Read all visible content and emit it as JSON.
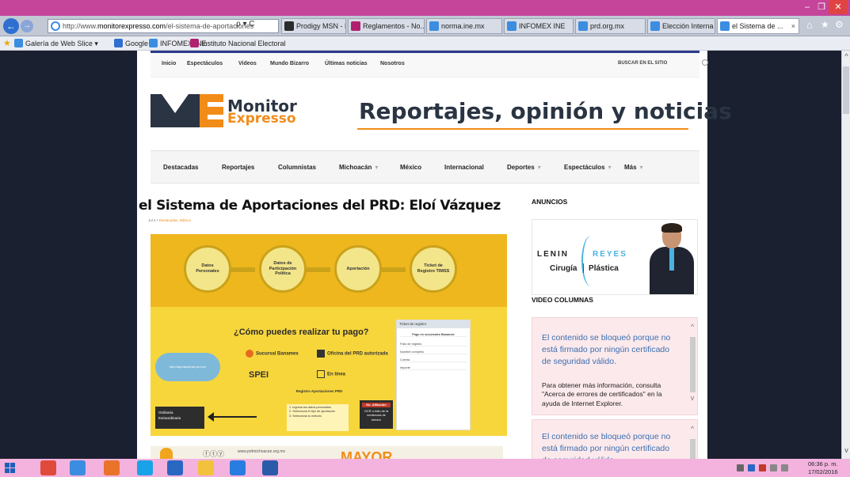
{
  "browser": {
    "window_buttons": {
      "minimize": "–",
      "maximize": "❐",
      "close": "✕"
    },
    "back_icon": "←",
    "forward_icon": "→",
    "url_prefix": "http://www.",
    "url_domain": "monitorexpresso.com",
    "url_path": "/el-sistema-de-aportaciones",
    "url_controls": "ρ ▾ C",
    "tabs": [
      {
        "label": "Prodigy MSN - Ho...",
        "color": "#2b2b2b"
      },
      {
        "label": "Reglamentos - No...",
        "color": "#b0206e"
      },
      {
        "label": "norma.ine.mx",
        "color": "#3b8de0"
      },
      {
        "label": "INFOMEX INE",
        "color": "#3b8de0"
      },
      {
        "label": "prd.org.mx",
        "color": "#3b8de0"
      },
      {
        "label": "Elección Interna P...",
        "color": "#3b8de0"
      },
      {
        "label": "el Sistema de ...",
        "color": "#3b8de0",
        "close": "×"
      }
    ],
    "toolbar_icons": {
      "home": "⌂",
      "favorites": "★",
      "settings": "⚙"
    },
    "favorites": [
      {
        "label": "Galería de Web Slice ▾",
        "color": "#3b8de0"
      },
      {
        "label": "Google",
        "color": "#2f6fd0"
      },
      {
        "label": "INFOMEX INE",
        "color": "#3b8de0"
      },
      {
        "label": "Instituto Nacional Electoral",
        "color": "#b0206e"
      }
    ]
  },
  "site": {
    "top_nav": [
      "Inicio",
      "Espectáculos",
      "Videos",
      "Mundo Bizarro",
      "Últimas noticias",
      "Nosotros"
    ],
    "search_label": "BUSCAR EN EL SITIO",
    "logo": {
      "mark": "ME",
      "name": "Monitor",
      "sub": "Expresso"
    },
    "tagline": "Reportajes, opinión y noticias",
    "main_nav": [
      {
        "label": "Destacadas",
        "dropdown": false
      },
      {
        "label": "Reportajes",
        "dropdown": false
      },
      {
        "label": "Columnistas",
        "dropdown": false
      },
      {
        "label": "Michoacán",
        "dropdown": true
      },
      {
        "label": "México",
        "dropdown": false
      },
      {
        "label": "Internacional",
        "dropdown": false
      },
      {
        "label": "Deportes",
        "dropdown": true
      },
      {
        "label": "Espectáculos",
        "dropdown": true
      },
      {
        "label": "Más",
        "dropdown": true
      }
    ],
    "dropdown_chevron": "▾"
  },
  "article": {
    "title": "el Sistema de Aportaciones del PRD: Eloí Vázquez",
    "date": "Jul 4 •",
    "categories": "Destacadas, México",
    "hero": {
      "steps": [
        "Datos Personales",
        "Datos de Participación Política",
        "Aportación",
        "Ticket de Registro TIMSS"
      ],
      "question": "¿Cómo puedes realizar tu pago?",
      "form_title": "Ticket de registro",
      "form_sub": "Pago en sucursales Banamex",
      "form_rows": [
        "Folio de registro",
        "Nombre completo",
        "Cuenta",
        "Importe"
      ],
      "cloud_text": "http://aportaciones.prd.mx",
      "option_sucursal": "Sucursal Banamex",
      "option_oficina": "Oficina del PRD autorizada",
      "option_spei": "SPEI",
      "option_linea": "En línea",
      "options_box": [
        "Ordinaria",
        "Extraordinaria"
      ],
      "registro": "Registro Aportaciones PRD",
      "steps_text": [
        "1. Ingresa tus datos personales",
        "2. Selecciona el tipo de aportación",
        "3. Selecciona tu método"
      ],
      "afil_head": "No. Afiliación",
      "afil_text": "OCR o folio de la credencial de elector"
    },
    "second_image": {
      "icons": "ⓕⓣⓨ",
      "url": "www.prdmichoacan.org.mx",
      "big": "MAYOR"
    }
  },
  "sidebar": {
    "anuncios": "ANUNCIOS",
    "ad": {
      "first": "LENIN",
      "last": "REYES",
      "sub1": "Cirugía",
      "sub2": "Plástica"
    },
    "video_columnas": "VIDEO COLUMNAS",
    "blocked_main": "El contenido se bloqueó porque no está firmado por ningún certificado de seguridad válido.",
    "blocked_info": "Para obtener más información, consulta \"Acerca de errores de certificados\" en la ayuda de Internet Explorer.",
    "blocked_main_2": "El contenido se bloqueó porque no está firmado por ningún certificado de seguridad válido.",
    "scroll_up": "^",
    "scroll_down": "v"
  },
  "taskbar": {
    "apps": [
      {
        "name": "chrome",
        "color": "#e04a3a"
      },
      {
        "name": "internet-explorer",
        "color": "#3b8de0"
      },
      {
        "name": "firefox",
        "color": "#e8732a"
      },
      {
        "name": "skype",
        "color": "#1aa2e8"
      },
      {
        "name": "outlook",
        "color": "#2a67c2"
      },
      {
        "name": "file-explorer",
        "color": "#f2c23c"
      },
      {
        "name": "teamviewer",
        "color": "#2a7de0"
      },
      {
        "name": "word",
        "color": "#2a5aa8"
      }
    ],
    "time": "06:36 p. m.",
    "date": "17/02/2016"
  }
}
